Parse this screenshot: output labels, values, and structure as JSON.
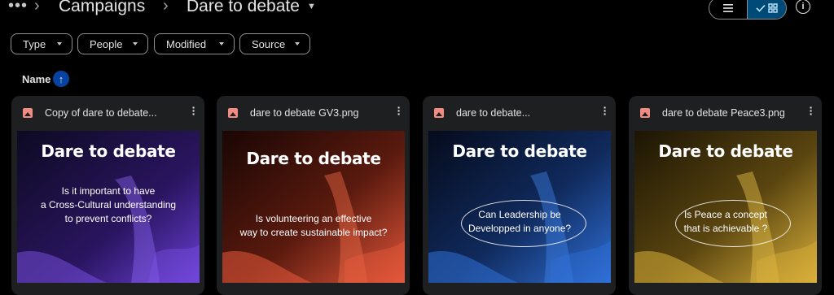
{
  "breadcrumb": {
    "more": "•••",
    "sep": "›",
    "parent": "Campaigns",
    "current": "Dare to debate"
  },
  "filters": [
    {
      "label": "Type"
    },
    {
      "label": "People"
    },
    {
      "label": "Modified"
    },
    {
      "label": "Source"
    }
  ],
  "sort": {
    "label": "Name",
    "direction_icon": "arrow-up-icon"
  },
  "files": [
    {
      "name": "Copy of dare to debate...",
      "thumb_title": "Dare to debate",
      "thumb_lines": [
        "Is it important to have",
        "a Cross-Cultural understanding",
        "to prevent conflicts?"
      ],
      "accent": "#6a3fd6"
    },
    {
      "name": "dare to debate GV3.png",
      "thumb_title": "Dare to debate",
      "thumb_lines": [
        "Is volunteering an effective",
        "way to create sustainable impact?"
      ],
      "accent": "#e0553a"
    },
    {
      "name": "dare to debate...",
      "thumb_title": "Dare to debate",
      "thumb_lines": [
        "Can Leadership be",
        "Developped in anyone?"
      ],
      "accent": "#2f6fd6"
    },
    {
      "name": "dare to debate Peace3.png",
      "thumb_title": "Dare to debate",
      "thumb_lines": [
        "Is Peace a concept",
        "that is achievable ?"
      ],
      "accent": "#d9b03a"
    }
  ],
  "colors": {
    "background": "#000000",
    "card": "#1e1f20",
    "selected_view": "#004a77",
    "image_icon": "#f28b82"
  }
}
